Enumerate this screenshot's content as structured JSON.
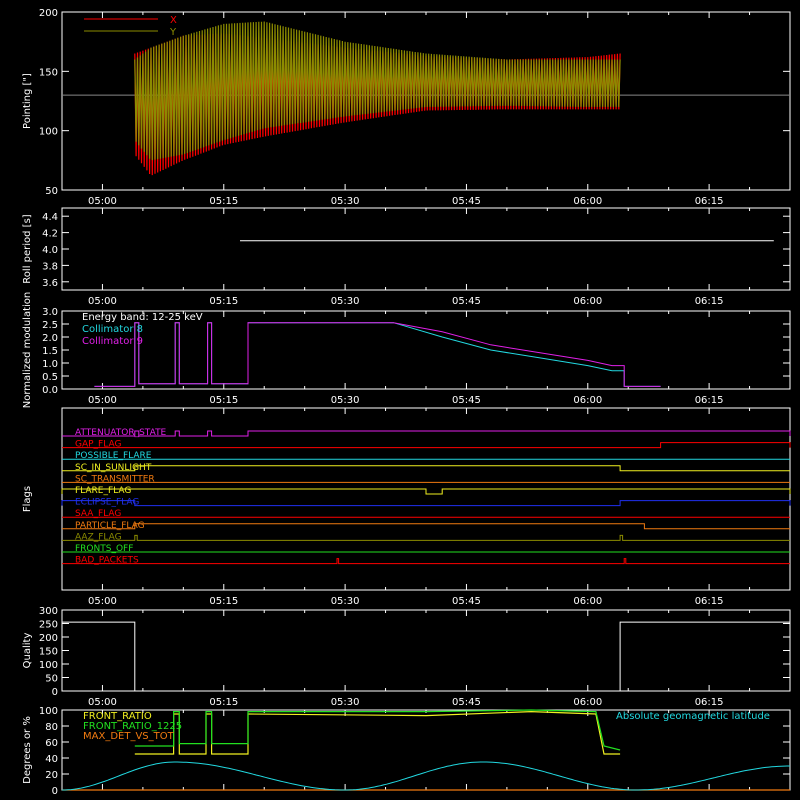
{
  "colors": {
    "background": "#000000",
    "frame": "#ffffff",
    "red": "#ff0000",
    "olive": "#8c8c00",
    "cyan": "#22d8e0",
    "magenta": "#e020e8",
    "green": "#22e020",
    "yellow": "#f0f020",
    "blue": "#2030f0",
    "orange": "#f07a10",
    "gray": "#888888",
    "white": "#ffffff"
  },
  "chart_data": [
    {
      "type": "line",
      "id": "pointing",
      "ylabel": "Pointing [\"]",
      "ylim": [
        50,
        200
      ],
      "yticks": [
        50,
        100,
        150,
        200
      ],
      "x_tick_labels": [
        "05:00",
        "05:15",
        "05:30",
        "05:45",
        "06:00",
        "06:15"
      ],
      "reference_line": 130,
      "legend": "top-left",
      "series": [
        {
          "name": "X",
          "color": "red",
          "envelope": [
            {
              "t": "05:04",
              "lo": 80,
              "hi": 165
            },
            {
              "t": "05:06",
              "lo": 62,
              "hi": 170
            },
            {
              "t": "05:10",
              "lo": 75,
              "hi": 180
            },
            {
              "t": "05:15",
              "lo": 88,
              "hi": 182
            },
            {
              "t": "05:20",
              "lo": 95,
              "hi": 178
            },
            {
              "t": "05:30",
              "lo": 107,
              "hi": 170
            },
            {
              "t": "05:40",
              "lo": 117,
              "hi": 163
            },
            {
              "t": "05:50",
              "lo": 118,
              "hi": 160
            },
            {
              "t": "06:00",
              "lo": 118,
              "hi": 162
            },
            {
              "t": "06:04",
              "lo": 118,
              "hi": 165
            }
          ]
        },
        {
          "name": "Y",
          "color": "olive",
          "envelope": [
            {
              "t": "05:04",
              "lo": 92,
              "hi": 160
            },
            {
              "t": "05:06",
              "lo": 75,
              "hi": 170
            },
            {
              "t": "05:10",
              "lo": 80,
              "hi": 180
            },
            {
              "t": "05:15",
              "lo": 92,
              "hi": 190
            },
            {
              "t": "05:20",
              "lo": 102,
              "hi": 192
            },
            {
              "t": "05:30",
              "lo": 112,
              "hi": 175
            },
            {
              "t": "05:40",
              "lo": 120,
              "hi": 165
            },
            {
              "t": "05:50",
              "lo": 121,
              "hi": 160
            },
            {
              "t": "06:00",
              "lo": 120,
              "hi": 160
            },
            {
              "t": "06:04",
              "lo": 120,
              "hi": 160
            }
          ]
        }
      ]
    },
    {
      "type": "line",
      "id": "roll",
      "ylabel": "Roll period [s]",
      "ylim": [
        3.5,
        4.5
      ],
      "yticks": [
        3.6,
        3.8,
        4.0,
        4.2,
        4.4
      ],
      "x_tick_labels": [
        "05:00",
        "05:15",
        "05:30",
        "05:45",
        "06:00",
        "06:15"
      ],
      "series": [
        {
          "name": "",
          "color": "white",
          "x": [
            "05:17",
            "06:23"
          ],
          "y": [
            4.1,
            4.1
          ]
        }
      ]
    },
    {
      "type": "line",
      "id": "modulation",
      "ylabel": "Normalized modulation",
      "ylim": [
        0,
        3
      ],
      "yticks": [
        0.0,
        0.5,
        1.0,
        1.5,
        2.0,
        2.5,
        3.0
      ],
      "x_tick_labels": [
        "05:00",
        "05:15",
        "05:30",
        "05:45",
        "06:00",
        "06:15"
      ],
      "legend_title": "Energy band: 12-25 keV",
      "legend": "top-left",
      "series": [
        {
          "name": "Collimator 8",
          "color": "cyan",
          "x": [
            "04:59",
            "05:04",
            "05:04",
            "05:04.5",
            "05:04.5",
            "05:09",
            "05:09",
            "05:09.5",
            "05:09.5",
            "05:13",
            "05:13",
            "05:13.5",
            "05:13.5",
            "05:18",
            "05:18",
            "05:36",
            "05:42",
            "05:48",
            "05:54",
            "06:00",
            "06:03",
            "06:04.5",
            "06:04.5",
            "06:09"
          ],
          "y": [
            0.1,
            0.1,
            2.55,
            2.55,
            0.2,
            0.2,
            2.55,
            2.55,
            0.2,
            0.2,
            2.55,
            2.55,
            0.2,
            0.2,
            2.55,
            2.55,
            2.0,
            1.5,
            1.2,
            0.9,
            0.7,
            0.7,
            0.1,
            0.1
          ]
        },
        {
          "name": "Collimator 9",
          "color": "magenta",
          "x": [
            "04:59",
            "05:04",
            "05:04",
            "05:04.5",
            "05:04.5",
            "05:09",
            "05:09",
            "05:09.5",
            "05:09.5",
            "05:13",
            "05:13",
            "05:13.5",
            "05:13.5",
            "05:18",
            "05:18",
            "05:36",
            "05:42",
            "05:48",
            "05:54",
            "06:00",
            "06:03",
            "06:04.5",
            "06:04.5",
            "06:09"
          ],
          "y": [
            0.1,
            0.1,
            2.55,
            2.55,
            0.2,
            0.2,
            2.55,
            2.55,
            0.2,
            0.2,
            2.55,
            2.55,
            0.2,
            0.2,
            2.55,
            2.55,
            2.2,
            1.7,
            1.4,
            1.1,
            0.9,
            0.9,
            0.1,
            0.1
          ]
        }
      ]
    },
    {
      "type": "line",
      "id": "flags",
      "ylabel": "Flags",
      "x_tick_labels": [
        "05:00",
        "05:15",
        "05:30",
        "05:45",
        "06:00",
        "06:15"
      ],
      "flags": [
        {
          "name": "ATTENUATOR_STATE",
          "color": "magenta",
          "on": [
            [
              "05:04",
              "05:04.5"
            ],
            [
              "05:09",
              "05:09.5"
            ],
            [
              "05:13",
              "05:13.5"
            ],
            [
              "05:18",
              "06:25"
            ]
          ]
        },
        {
          "name": "GAP_FLAG",
          "color": "red",
          "on": [
            [
              "06:09",
              "06:25"
            ]
          ]
        },
        {
          "name": "POSSIBLE_FLARE",
          "color": "cyan",
          "on": []
        },
        {
          "name": "SC_IN_SUNLIGHT",
          "color": "yellow",
          "on": [
            [
              "05:04",
              "06:04"
            ]
          ]
        },
        {
          "name": "SC_TRANSMITTER",
          "color": "orange",
          "on": []
        },
        {
          "name": "FLARE_FLAG",
          "color": "yellow",
          "on": [
            [
              "04:55",
              "05:40"
            ],
            [
              "05:42",
              "06:25"
            ]
          ]
        },
        {
          "name": "ECLIPSE_FLAG",
          "color": "blue",
          "on": [
            [
              "04:55",
              "05:04"
            ],
            [
              "06:04",
              "06:25"
            ]
          ]
        },
        {
          "name": "SAA_FLAG",
          "color": "red",
          "on": []
        },
        {
          "name": "PARTICLE_FLAG",
          "color": "orange",
          "on": [
            [
              "05:04",
              "06:07"
            ]
          ]
        },
        {
          "name": "AAZ_FLAG",
          "color": "olive",
          "on": [
            [
              "05:04",
              "05:04.3"
            ],
            [
              "06:04",
              "06:04.3"
            ]
          ]
        },
        {
          "name": "FRONTS_OFF",
          "color": "green",
          "on": []
        },
        {
          "name": "BAD_PACKETS",
          "color": "red",
          "on": [
            [
              "05:29",
              "05:29.2"
            ],
            [
              "06:04.5",
              "06:04.7"
            ]
          ]
        }
      ]
    },
    {
      "type": "line",
      "id": "quality",
      "ylabel": "Quality",
      "ylim": [
        0,
        300
      ],
      "yticks": [
        0,
        50,
        100,
        150,
        200,
        250,
        300
      ],
      "x_tick_labels": [
        "05:00",
        "05:15",
        "05:30",
        "05:45",
        "06:00",
        "06:15"
      ],
      "series": [
        {
          "name": "",
          "color": "white",
          "x": [
            "04:55",
            "05:04",
            "05:04",
            "06:04",
            "06:04",
            "06:25"
          ],
          "y": [
            255,
            255,
            0,
            0,
            255,
            255
          ]
        }
      ]
    },
    {
      "type": "line",
      "id": "ratios",
      "ylabel": "Degrees or %",
      "ylim": [
        0,
        100
      ],
      "yticks": [
        0,
        20,
        40,
        60,
        80,
        100
      ],
      "legend": "top-left",
      "series": [
        {
          "name": "FRONT_RATIO",
          "color": "yellow",
          "x": [
            "05:04",
            "05:08.8",
            "05:08.8",
            "05:09.5",
            "05:09.5",
            "05:12.8",
            "05:12.8",
            "05:13.5",
            "05:13.5",
            "05:18",
            "05:18",
            "05:40",
            "05:40",
            "05:53",
            "05:53",
            "06:01",
            "06:01",
            "06:02",
            "06:02",
            "06:04"
          ],
          "y": [
            45,
            45,
            95,
            95,
            45,
            45,
            95,
            95,
            45,
            45,
            95,
            93,
            93,
            98,
            98,
            95,
            95,
            45,
            45,
            45
          ]
        },
        {
          "name": "FRONT_RATIO_1225",
          "color": "green",
          "x": [
            "05:04",
            "05:08.8",
            "05:08.8",
            "05:09.5",
            "05:09.5",
            "05:12.8",
            "05:12.8",
            "05:13.5",
            "05:13.5",
            "05:18",
            "05:18",
            "05:40",
            "05:40",
            "05:53",
            "05:53",
            "06:01",
            "06:01",
            "06:02",
            "06:02",
            "06:04"
          ],
          "y": [
            55,
            55,
            98,
            98,
            58,
            58,
            98,
            98,
            58,
            58,
            98,
            98,
            98,
            100,
            100,
            98,
            98,
            55,
            55,
            50
          ]
        },
        {
          "name": "MAX_DET_VS_TOT",
          "color": "orange",
          "x": [
            "04:55",
            "06:25"
          ],
          "y": [
            0,
            0
          ]
        },
        {
          "name": "Absolute geomagnetic latitude",
          "color": "cyan",
          "x": [
            "04:55",
            "05:09",
            "05:30",
            "05:47",
            "06:06",
            "06:25"
          ],
          "y": [
            0,
            35,
            0,
            35,
            0,
            30
          ]
        }
      ]
    }
  ]
}
